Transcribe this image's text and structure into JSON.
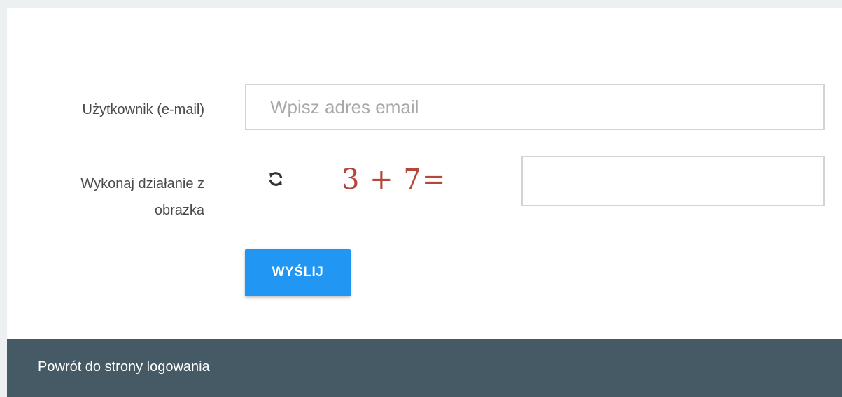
{
  "form": {
    "email_label": "Użytkownik (e-mail)",
    "email_placeholder": "Wpisz adres email",
    "email_value": "",
    "captcha_label_line1": "Wykonaj działanie z",
    "captcha_label_line2": "obrazka",
    "captcha_expression": "3 + 7=",
    "captcha_value": "",
    "refresh_icon": "refresh-icon",
    "submit_label": "WYŚLIJ"
  },
  "footer": {
    "back_link": "Powrót do strony logowania"
  },
  "colors": {
    "background": "#ecf0f1",
    "card": "#ffffff",
    "primary_button": "#2196f3",
    "footer": "#455a64",
    "captcha_text": "#b5473a",
    "input_border": "#d3d3d3"
  }
}
